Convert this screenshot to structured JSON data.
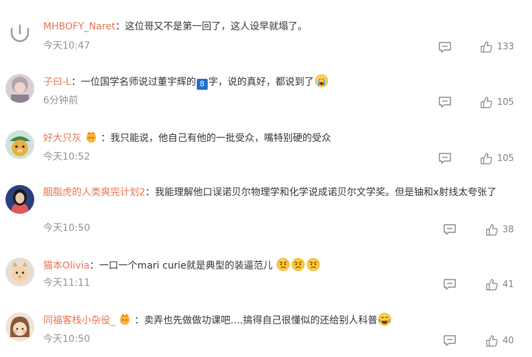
{
  "comments": [
    {
      "username": "MHBOFY_Naret",
      "avatar": "default-avatar-icon",
      "text": "这位哥又不是第一回了，这人设早就塌了。",
      "time": "今天10:47",
      "likes": "133"
    },
    {
      "username": "子曰-L",
      "avatar": "girl-photo",
      "text_a": "一位国学名师说过董宇辉的",
      "badge": "8",
      "text_b": "字，说的真好，都说到了",
      "emoji": "crying-face",
      "time": "6分钟前",
      "likes": "105"
    },
    {
      "username": "好大只灰",
      "avatar": "cartoon-bear",
      "badge_icon": "orange-fan-badge-icon",
      "text": "我只能说，他自己有他的一批受众，嘴特别硬的受众",
      "time": "今天10:52",
      "likes": "105"
    },
    {
      "username": "胭脂虎的人类爽完计划2",
      "avatar": "woman-photo",
      "text": "我能理解他口误诺贝尔物理学和化学说成诺贝尔文学奖。但是铀和x射线太夸张了",
      "time": "今天10:50",
      "likes": "38"
    },
    {
      "username": "猫本Olivia",
      "avatar": "cat-photo",
      "text": "一口一个mari curie就是典型的装逼范儿",
      "emoji": "angry-face",
      "time": "今天11:11",
      "likes": "41"
    },
    {
      "username": "同福客栈小杂役_",
      "avatar": "cartoon-girl",
      "badge_icon": "orange-fan-badge-icon",
      "text": "卖弄也先做做功课吧….搞得自己很懂似的还给别人科普",
      "emoji": "laughing-tears-face",
      "time": "今天10:50",
      "likes": "40"
    }
  ],
  "separator": "："
}
